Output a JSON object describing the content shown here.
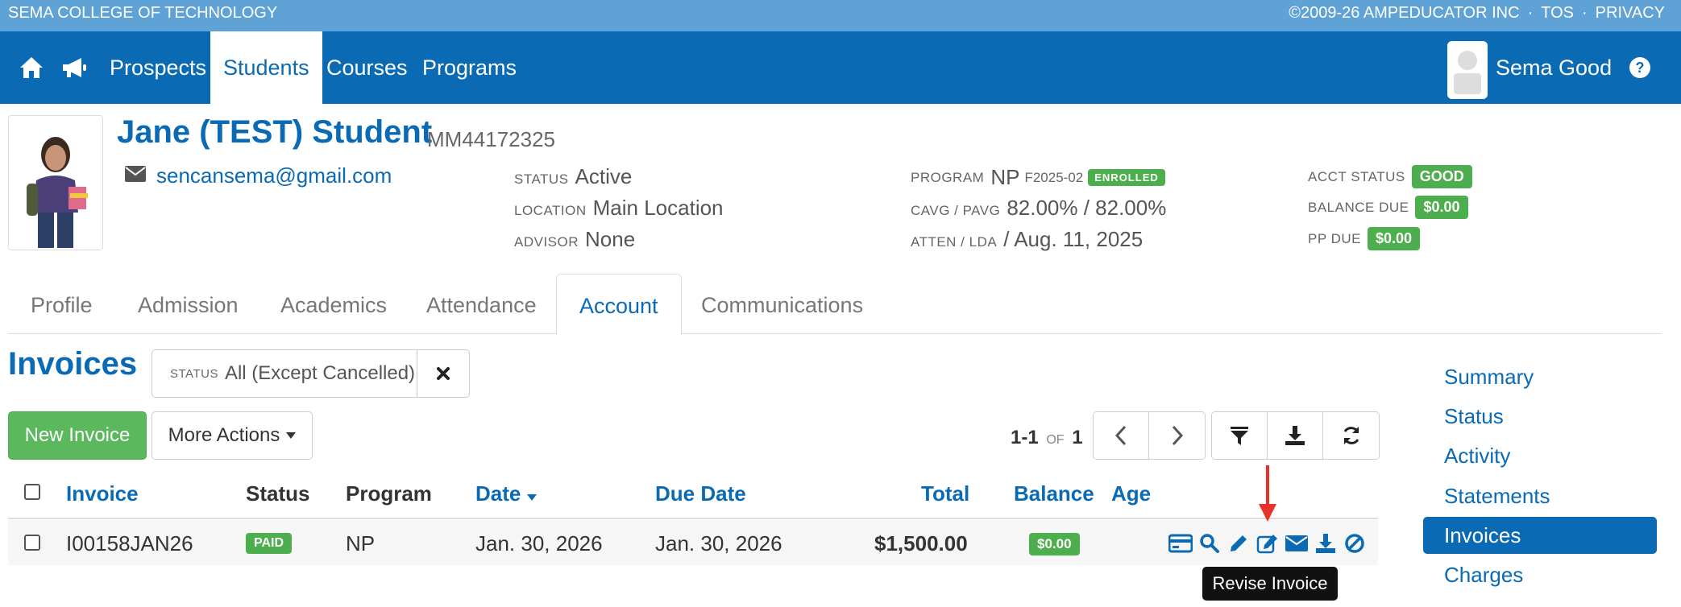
{
  "topbar": {
    "school": "SEMA COLLEGE OF TECHNOLOGY",
    "copyright": "©2009-26 AMPEDUCATOR INC",
    "sep1": "·",
    "tos": "TOS",
    "sep2": "·",
    "privacy": "PRIVACY"
  },
  "nav": {
    "items": [
      {
        "label": "Prospects"
      },
      {
        "label": "Students"
      },
      {
        "label": "Courses"
      },
      {
        "label": "Programs"
      }
    ],
    "user": "Sema Good"
  },
  "student": {
    "name": "Jane (TEST) Student",
    "id": "MM44172325",
    "email": "sencansema@gmail.com",
    "status_label": "STATUS",
    "status": "Active",
    "location_label": "LOCATION",
    "location": "Main Location",
    "advisor_label": "ADVISOR",
    "advisor": "None",
    "program_label": "PROGRAM",
    "program": "NP",
    "program_code": "F2025-02",
    "program_badge": "ENROLLED",
    "cavg_label": "CAVG / PAVG",
    "cavg": "82.00% / 82.00%",
    "atten_label": "ATTEN / LDA",
    "atten": "/ Aug. 11, 2025",
    "acct_status_label": "ACCT STATUS",
    "acct_status": "GOOD",
    "balance_due_label": "BALANCE DUE",
    "balance_due": "$0.00",
    "pp_due_label": "PP DUE",
    "pp_due": "$0.00"
  },
  "tabs": [
    "Profile",
    "Admission",
    "Academics",
    "Attendance",
    "Account",
    "Communications"
  ],
  "invoices": {
    "title": "Invoices",
    "filter_label": "STATUS",
    "filter_value": "All (Except Cancelled)",
    "new_button": "New Invoice",
    "more_button": "More Actions",
    "pager_range": "1-1",
    "pager_of": "OF",
    "pager_total": "1",
    "columns": [
      "Invoice",
      "Status",
      "Program",
      "Date",
      "Due Date",
      "Total",
      "Balance",
      "Age"
    ],
    "rows": [
      {
        "invoice": "I00158JAN26",
        "status": "PAID",
        "program": "NP",
        "date": "Jan. 30, 2026",
        "due_date": "Jan. 30, 2026",
        "total": "$1,500.00",
        "balance": "$0.00",
        "age": ""
      }
    ],
    "tooltip": "Revise Invoice"
  },
  "sidebar": [
    "Summary",
    "Status",
    "Activity",
    "Statements",
    "Invoices",
    "Charges"
  ],
  "colors": {
    "primary": "#0a6ab4",
    "topbar": "#5fa2d5",
    "success": "#5cb85c",
    "arrow": "#e8332a"
  }
}
